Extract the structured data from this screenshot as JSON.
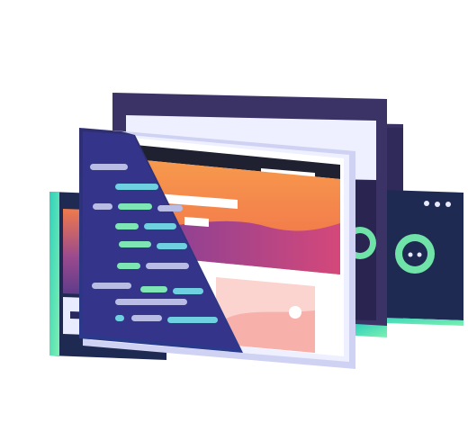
{
  "palette": {
    "navy": "#2b2860",
    "deep_navy": "#1f2a52",
    "purple_frame": "#3a3163",
    "indigo": "#33337a",
    "teal": "#3fd6c2",
    "green": "#6fe3a8",
    "code_light": "#b9bde6",
    "code_green": "#7ee6b5",
    "code_teal": "#6fd0e0",
    "orange": "#f5874a",
    "coral": "#f06a4e",
    "magenta": "#b0468f",
    "violet": "#7b3f9a",
    "pink_light": "#fbd3cf",
    "pink_mid": "#f7b0aa",
    "frame_light": "#eef0ff",
    "frame_shadow": "#cfd2f2",
    "white": "#ffffff"
  },
  "icons": {
    "window_dots": "three-dots-icon",
    "image_placeholder": "image-placeholder-icon",
    "toggle": "circular-toggle-icon"
  }
}
